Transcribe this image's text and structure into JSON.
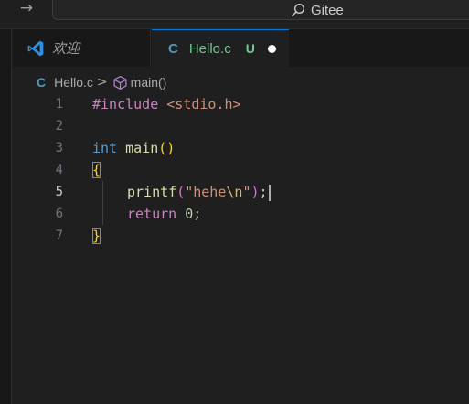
{
  "titlebar": {
    "nav_forward_icon": "arrow-right-icon",
    "search_icon": "search-icon",
    "command_center_label": "Gitee"
  },
  "tabs": [
    {
      "icon": "vscode-logo-icon",
      "label": "欢迎",
      "active": false
    },
    {
      "icon": "c-file-icon",
      "icon_text": "C",
      "label": "Hello.c",
      "status": "U",
      "modified_dot": true,
      "active": true
    }
  ],
  "breadcrumb": {
    "file_icon_text": "C",
    "file": "Hello.c",
    "separator": ">",
    "symbol_icon": "symbol-method-icon",
    "symbol": "main()"
  },
  "editor": {
    "active_line": 5,
    "lines": [
      {
        "number": "1",
        "include": "#include",
        "header": "<stdio.h>"
      },
      {
        "number": "2"
      },
      {
        "number": "3",
        "type": "int",
        "name": "main",
        "parens": "()"
      },
      {
        "number": "4",
        "brace": "{"
      },
      {
        "number": "5",
        "fn": "printf",
        "open": "(",
        "str1": "\"hehe",
        "esc": "\\n",
        "str2": "\"",
        "close": ")",
        "semi": ";"
      },
      {
        "number": "6",
        "kw": "return",
        "num": "0",
        "semi": ";"
      },
      {
        "number": "7",
        "brace": "}"
      }
    ]
  },
  "colors": {
    "accent": "#0078d4",
    "untracked": "#73c991",
    "c_icon": "#519aba"
  }
}
